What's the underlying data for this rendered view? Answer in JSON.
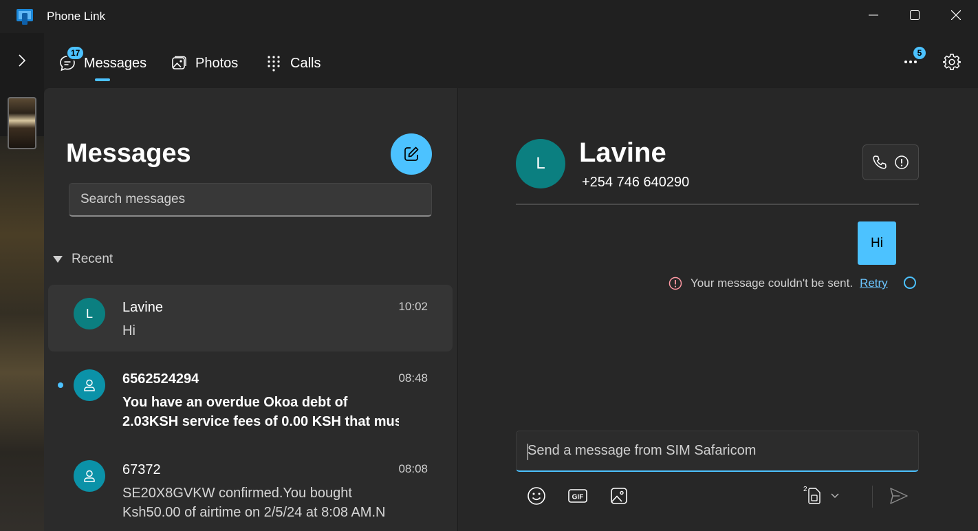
{
  "window": {
    "title": "Phone Link"
  },
  "nav": {
    "tabs": [
      {
        "label": "Messages",
        "badge": "17",
        "active": true
      },
      {
        "label": "Photos"
      },
      {
        "label": "Calls"
      }
    ],
    "more_badge": "5"
  },
  "list": {
    "heading": "Messages",
    "search_placeholder": "Search messages",
    "section_label": "Recent",
    "conversations": [
      {
        "avatar": "L",
        "name": "Lavine",
        "time": "10:02",
        "preview_lines": [
          "Hi"
        ],
        "selected": true,
        "unread": false
      },
      {
        "avatar": "person-icon",
        "name": "6562524294",
        "time": "08:48",
        "preview_lines": [
          "You have an overdue Okoa debt of",
          "2.03KSH service fees of 0.00 KSH that mus"
        ],
        "selected": false,
        "unread": true
      },
      {
        "avatar": "person-icon",
        "name": "67372",
        "time": "08:08",
        "preview_lines": [
          "SE20X8GVKW confirmed.You bought",
          "Ksh50.00 of airtime on 2/5/24 at 8:08 AM.N"
        ],
        "selected": false,
        "unread": false
      }
    ]
  },
  "conversation": {
    "contact_initial": "L",
    "contact_name": "Lavine",
    "contact_phone": "+254 746 640290",
    "messages": [
      {
        "text": "Hi",
        "direction": "outgoing",
        "status": "failed"
      }
    ],
    "error_text": "Your message couldn't be sent.",
    "retry_label": "Retry",
    "composer_placeholder": "Send a message from SIM Safaricom",
    "sim_label": "2"
  },
  "colors": {
    "accent": "#4cc2ff",
    "avatar_teal": "#0b7f80",
    "avatar_cyan": "#0b92a8",
    "error": "#ff99a4",
    "background": "#202020"
  },
  "icons": [
    "phone-link-logo-icon",
    "minimize-icon",
    "maximize-icon",
    "close-icon",
    "chevron-right-icon",
    "chat-icon",
    "photos-icon",
    "keypad-icon",
    "more-icon",
    "gear-icon",
    "compose-icon",
    "triangle-down-icon",
    "person-icon",
    "call-icon",
    "info-icon",
    "error-icon",
    "emoji-icon",
    "gif-icon",
    "image-icon",
    "sim-icon",
    "chevron-down-icon",
    "send-icon"
  ]
}
